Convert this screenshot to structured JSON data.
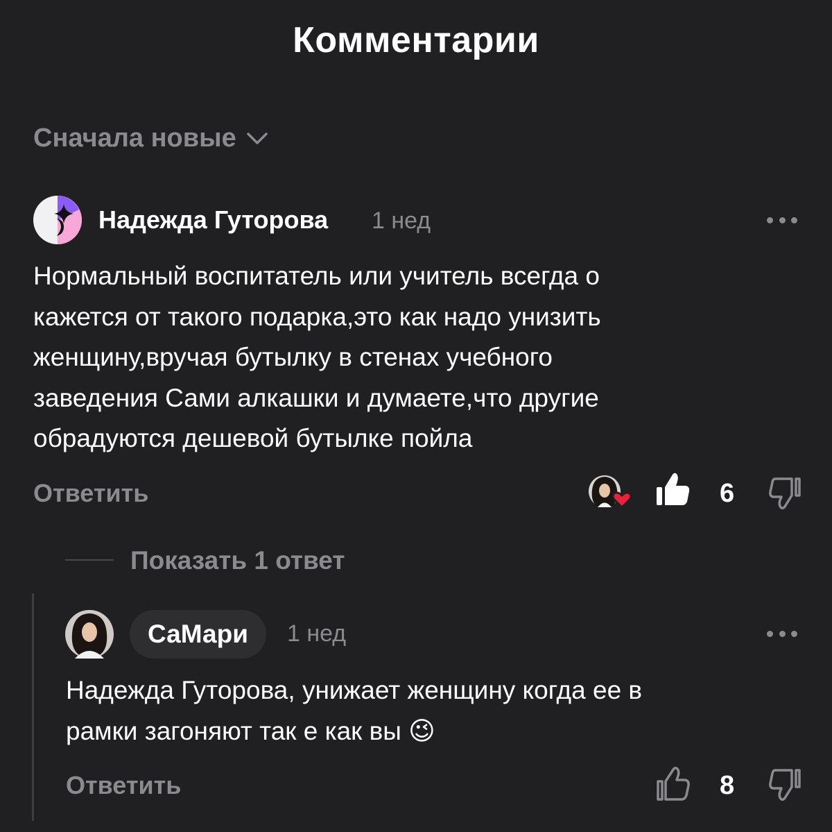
{
  "header": {
    "title": "Комментарии"
  },
  "sort": {
    "label": "Сначала новые"
  },
  "comment": {
    "author": "Надежда Гуторова",
    "time": "1 нед",
    "text": "Нормальный воспитатель или учитель всегда о\nкажется от такого подарка,это как надо унизить\nженщину,вручая бутылку в стенах учебного\nзаведения Сами алкашки и думаете,что другие\nобрадуются дешевой бутылке пойла",
    "reply_label": "Ответить",
    "likes": "6",
    "author_heart": true
  },
  "show_replies": {
    "label": "Показать 1 ответ"
  },
  "reply": {
    "author": "СаМари",
    "time": "1 нед",
    "text": "Надежда Гуторова, унижает женщину когда ее в\nрамки загоняют так е как вы",
    "emoji": "😉",
    "reply_label": "Ответить",
    "likes": "8"
  },
  "colors": {
    "background": "#202022",
    "text": "#ffffff",
    "muted": "#8b8b8f",
    "heart": "#e8223a",
    "brand_purple": "#8a5cf5",
    "brand_pink": "#f7a8d8"
  }
}
